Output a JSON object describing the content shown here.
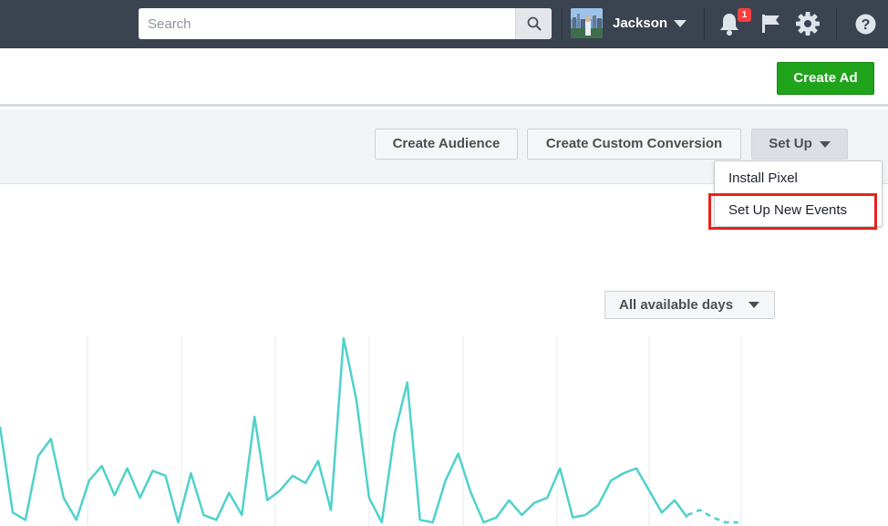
{
  "topbar": {
    "search": {
      "placeholder": "Search",
      "value": ""
    },
    "user": {
      "name": "Jackson"
    },
    "notifications": {
      "count": "1"
    },
    "icons": [
      "search-icon",
      "chevron-down-icon",
      "bell-icon",
      "flag-icon",
      "gear-icon",
      "help-icon"
    ]
  },
  "header": {
    "create_ad_label": "Create Ad"
  },
  "toolbar": {
    "create_audience_label": "Create Audience",
    "create_custom_conversion_label": "Create Custom Conversion",
    "setup_label": "Set Up"
  },
  "setup_menu": {
    "items": [
      {
        "label": "Install Pixel"
      },
      {
        "label": "Set Up New Events",
        "highlighted": true
      }
    ]
  },
  "range": {
    "label": "All available days"
  },
  "colors": {
    "topbar": "#3b4250",
    "primary_button": "#1fa41b",
    "line": "#4fd1cb",
    "highlight": "#e8231a",
    "badge": "#fa3e3e"
  },
  "chart_data": {
    "type": "line",
    "grid": "vertical",
    "series": [
      {
        "values": [
          39,
          4,
          1,
          27,
          34,
          10,
          1,
          17,
          23,
          11,
          22,
          10,
          21,
          19,
          0,
          20,
          3,
          1,
          12,
          3,
          43,
          9,
          13,
          19,
          16,
          25,
          5,
          75,
          50,
          10,
          0,
          36,
          57,
          1,
          0,
          17,
          28,
          12,
          0,
          2,
          9,
          3,
          8,
          10,
          22,
          2,
          3,
          7,
          17,
          20,
          22,
          13,
          4,
          9,
          2
        ]
      },
      {
        "style": "dashed",
        "values": [
          3,
          5,
          2,
          0,
          0
        ]
      }
    ]
  }
}
